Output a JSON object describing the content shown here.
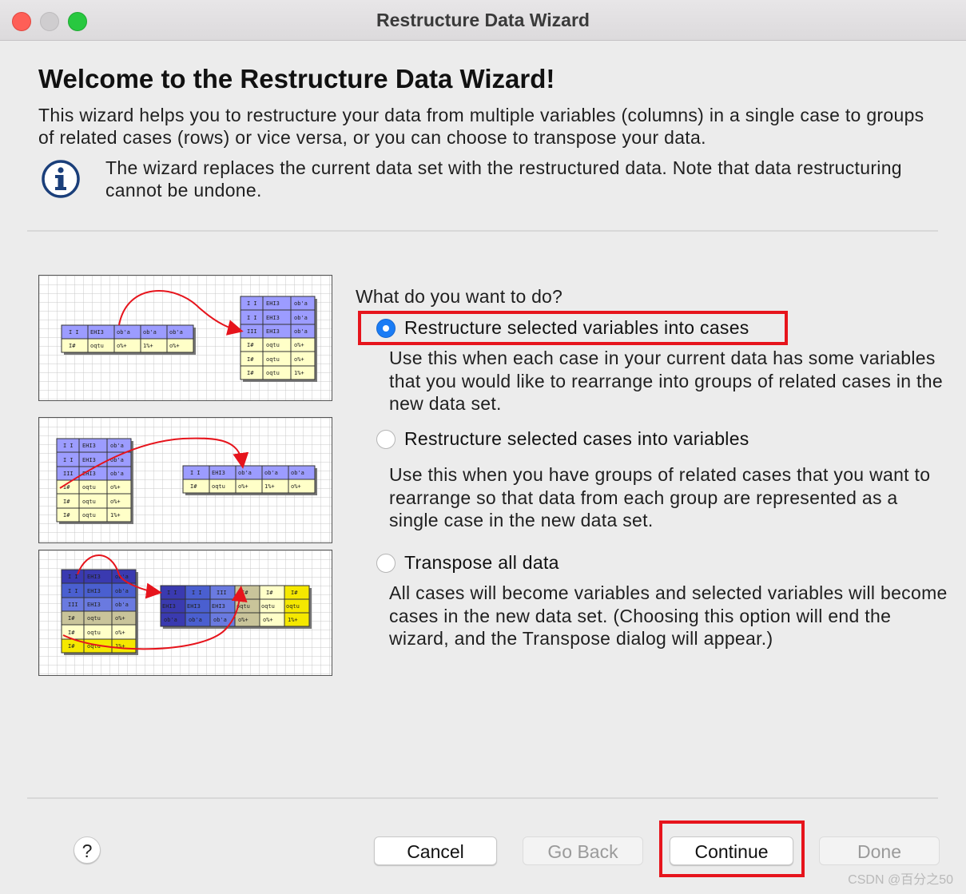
{
  "window": {
    "title": "Restructure Data Wizard"
  },
  "heading": "Welcome to the Restructure Data Wizard!",
  "intro": "This wizard helps you to restructure your data from multiple variables (columns) in a single case to groups of related cases (rows) or vice versa, or you can choose to transpose your data.",
  "info": {
    "icon": "info-icon",
    "text": "The wizard replaces the current data set with the restructured data.  Note that data restructuring cannot be undone."
  },
  "question": "What do you want to do?",
  "options": [
    {
      "label": "Restructure selected variables into cases",
      "selected": true,
      "description": "Use this when each case in your current data has some variables that you would like to rearrange into groups of related cases in the new data set."
    },
    {
      "label": "Restructure selected cases into variables",
      "selected": false,
      "description": "Use this when you have groups of related cases that you want to rearrange so that data from each group are represented as a single case in the new data set."
    },
    {
      "label": "Transpose all data",
      "selected": false,
      "description": "All cases will become variables and selected variables will become cases in the new data set. (Choosing this option will end the wizard, and the Transpose dialog will appear.)"
    }
  ],
  "buttons": {
    "help": "?",
    "cancel": "Cancel",
    "back": "Go Back",
    "continue": "Continue",
    "done": "Done"
  },
  "colors": {
    "accent": "#1a7cf5",
    "highlight": "#e6141c",
    "header_cell": "#9c9cff",
    "data_cell": "#ffffc8",
    "arrow": "#e6141c"
  },
  "watermark": "CSDN @百分之50"
}
